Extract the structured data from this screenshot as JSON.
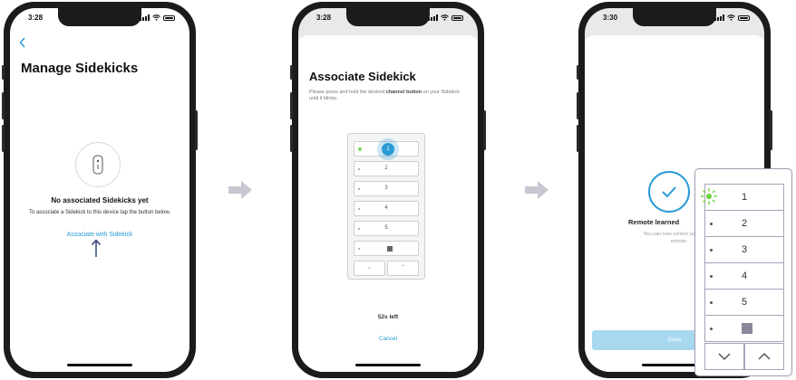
{
  "colors": {
    "accent": "#2a9bd6",
    "led_green": "#7ed957",
    "frame": "#1b1b1d",
    "arrow": "#c8c8d2"
  },
  "screen1": {
    "time": "3:28",
    "back_icon": "chevron-left-icon",
    "title": "Manage Sidekicks",
    "empty_heading": "No associated Sidekicks yet",
    "empty_body": "To associate a Sidekick to this device tap the button below.",
    "link": "Associate with Sidekick"
  },
  "screen2": {
    "time": "3:28",
    "title": "Associate Sidekick",
    "instruction_prefix": "Please press and hold the desired ",
    "instruction_bold": "channel button",
    "instruction_suffix": " on your Sidekick until it blinks.",
    "channels": [
      "1",
      "2",
      "3",
      "4",
      "5"
    ],
    "timer": "52s left",
    "cancel": "Cancel"
  },
  "screen3": {
    "time": "3:30",
    "heading": "Remote learned",
    "body_line1": "You can now control your device",
    "body_line2": "remote.",
    "done": "Done"
  },
  "zoom": {
    "channels": [
      "1",
      "2",
      "3",
      "4",
      "5"
    ],
    "active_channel": "1"
  }
}
